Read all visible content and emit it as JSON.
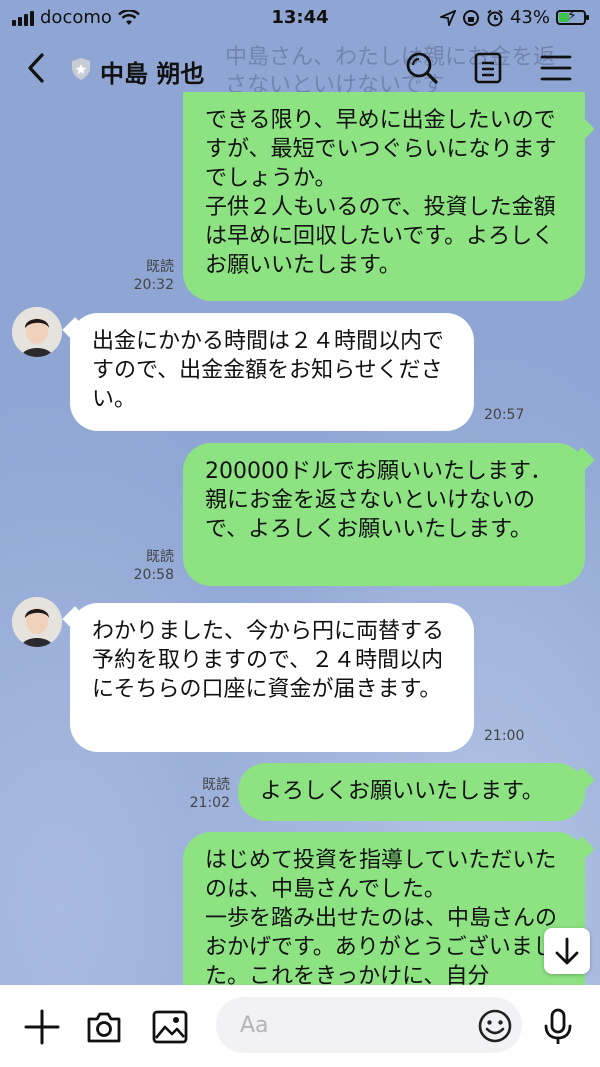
{
  "status_bar": {
    "carrier": "docomo",
    "time": "13:44",
    "battery": "43%",
    "battery_level": 0.43
  },
  "header": {
    "title": "中島 朔也",
    "back_icon": "chevron-left-icon",
    "search_icon": "search-icon",
    "notes_icon": "notes-icon",
    "menu_icon": "menu-icon"
  },
  "ghost_text": "中島さん、わたしは親にお金を返さないといけないです",
  "messages": [
    {
      "side": "out",
      "text": "できる限り、早めに出金したいのですが、最短でいつぐらいになりますでしょうか。\n子供２人もいるので、投資した金額は早めに回収したいです。よろしくお願いいたします。",
      "read": "既読",
      "time": "20:32"
    },
    {
      "side": "in",
      "text": "出金にかかる時間は２４時間以内ですので、出金金額をお知らせください。",
      "time": "20:57"
    },
    {
      "side": "out",
      "text": "200000ドルでお願いいたします．親にお金を返さないといけないので、よろしくお願いいたします。",
      "read": "既読",
      "time": "20:58"
    },
    {
      "side": "in",
      "text": "わかりました、今から円に両替する予約を取りますので、２４時間以内にそちらの口座に資金が届きます。",
      "time": "21:00"
    },
    {
      "side": "out",
      "text": "よろしくお願いいたします。",
      "read": "既読",
      "time": "21:02"
    },
    {
      "side": "out",
      "text": "はじめて投資を指導していただいたのは、中島さんでした。\n一歩を踏み出せたのは、中島さんのおかげです。ありがとうございました。これをきっかけに、自分"
    }
  ],
  "input": {
    "placeholder": "Aa"
  },
  "icons": {
    "plus": "plus-icon",
    "camera": "camera-icon",
    "image": "image-icon",
    "emoji": "emoji-icon",
    "mic": "microphone-icon",
    "scroll": "arrow-down-icon"
  },
  "colors": {
    "background": "#8fa6d4",
    "outgoing_bubble": "#8de282",
    "incoming_bubble": "#ffffff"
  }
}
